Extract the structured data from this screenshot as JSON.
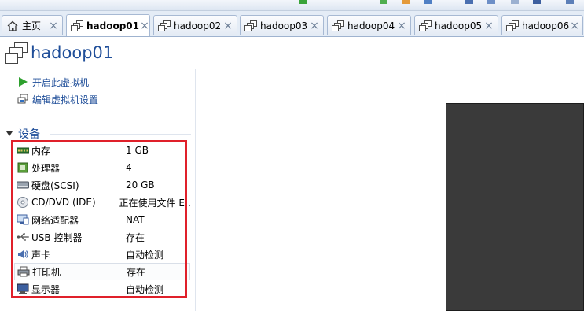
{
  "tabs": [
    {
      "label": "主页",
      "icon": "home-icon",
      "active": false
    },
    {
      "label": "hadoop01",
      "icon": "vm-icon",
      "active": true
    },
    {
      "label": "hadoop02",
      "icon": "vm-icon",
      "active": false
    },
    {
      "label": "hadoop03",
      "icon": "vm-icon",
      "active": false
    },
    {
      "label": "hadoop04",
      "icon": "vm-icon",
      "active": false
    },
    {
      "label": "hadoop05",
      "icon": "vm-icon",
      "active": false
    },
    {
      "label": "hadoop06",
      "icon": "vm-icon",
      "active": false
    }
  ],
  "tab_close_symbol": "×",
  "vm_title": "hadoop01",
  "actions": {
    "power_on": "开启此虚拟机",
    "edit_settings": "编辑虚拟机设置"
  },
  "devices_section": "设备",
  "devices": [
    {
      "name": "内存",
      "value": "1 GB",
      "icon": "memory-icon"
    },
    {
      "name": "处理器",
      "value": "4",
      "icon": "cpu-icon"
    },
    {
      "name": "硬盘(SCSI)",
      "value": "20 GB",
      "icon": "hard-disk-icon"
    },
    {
      "name": "CD/DVD (IDE)",
      "value": "正在使用文件 E:...",
      "icon": "cd-dvd-icon"
    },
    {
      "name": "网络适配器",
      "value": "NAT",
      "icon": "network-adapter-icon"
    },
    {
      "name": "USB 控制器",
      "value": "存在",
      "icon": "usb-icon"
    },
    {
      "name": "声卡",
      "value": "自动检测",
      "icon": "sound-card-icon"
    },
    {
      "name": "打印机",
      "value": "存在",
      "icon": "printer-icon"
    },
    {
      "name": "显示器",
      "value": "自动检测",
      "icon": "display-icon"
    }
  ],
  "colors": {
    "link_blue": "#1f4e99",
    "highlight_red": "#e0202a",
    "play_green": "#2ea02e",
    "screen_dark": "#3a3a3a"
  }
}
